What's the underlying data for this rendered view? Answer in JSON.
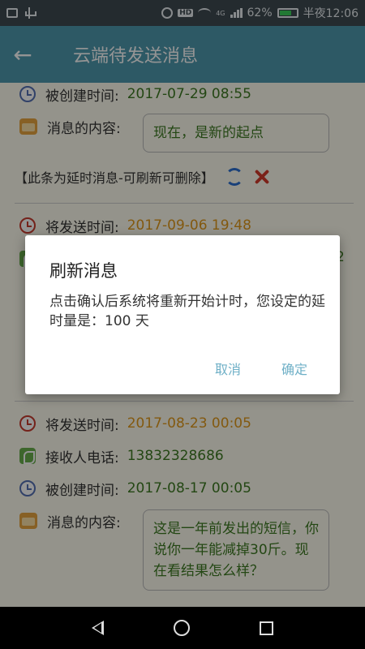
{
  "status_bar": {
    "battery": "62%",
    "time": "半夜12:06",
    "hd": "HD",
    "network": "4G"
  },
  "toolbar": {
    "title": "云端待发送消息"
  },
  "messages": [
    {
      "created_label": "被创建时间:",
      "created_time": "2017-07-29 08:55",
      "content_label": "消息的内容:",
      "content": "现在，是新的起点",
      "note": "【此条为延时消息-可刷新可删除】"
    },
    {
      "send_label": "将发送时间:",
      "send_time": "2017-09-06 19:48",
      "phone_partial": "2"
    },
    {
      "send_label": "将发送时间:",
      "send_time": "2017-08-23 00:05",
      "phone_label": "接收人电话:",
      "phone": "13832328686",
      "created_label": "被创建时间:",
      "created_time": "2017-08-17 00:05",
      "content_label": "消息的内容:",
      "content": "这是一年前发出的短信，你说你一年能减掉30斤。现在看结果怎么样？"
    }
  ],
  "dialog": {
    "title": "刷新消息",
    "message": "点击确认后系统将重新开始计时，您设定的延时量是：100 天",
    "cancel": "取消",
    "ok": "确定"
  },
  "colors": {
    "toolbar": "#4e9aae",
    "value_green": "#3d7a22",
    "value_orange": "#e29a1a",
    "dialog_button": "#6fb0c7"
  }
}
